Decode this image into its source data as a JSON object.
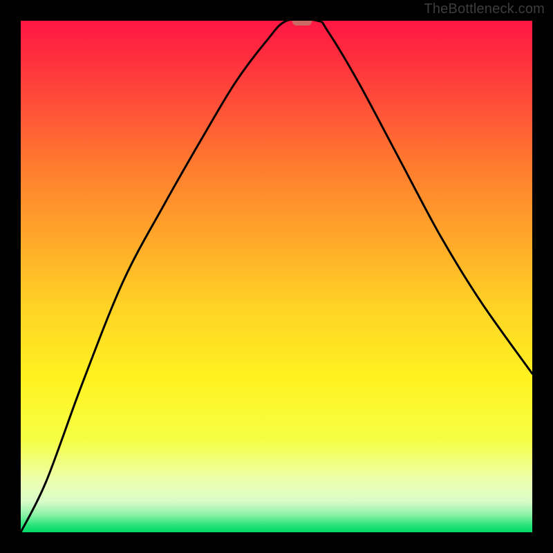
{
  "attribution": "TheBottleneck.com",
  "chart_data": {
    "type": "line",
    "title": "",
    "xlabel": "",
    "ylabel": "",
    "xlim": [
      0,
      100
    ],
    "ylim": [
      0,
      100
    ],
    "grid": false,
    "legend": null,
    "curve": [
      {
        "x": 0,
        "y": 0
      },
      {
        "x": 5,
        "y": 10
      },
      {
        "x": 12,
        "y": 29
      },
      {
        "x": 20,
        "y": 49
      },
      {
        "x": 28,
        "y": 64
      },
      {
        "x": 36,
        "y": 78
      },
      {
        "x": 42,
        "y": 88
      },
      {
        "x": 48,
        "y": 96
      },
      {
        "x": 52,
        "y": 100
      },
      {
        "x": 58,
        "y": 100
      },
      {
        "x": 60,
        "y": 98
      },
      {
        "x": 66,
        "y": 88
      },
      {
        "x": 74,
        "y": 73
      },
      {
        "x": 82,
        "y": 58
      },
      {
        "x": 90,
        "y": 45
      },
      {
        "x": 100,
        "y": 31
      }
    ],
    "marker": {
      "x": 55,
      "y": 100,
      "color": "#cb6a63"
    },
    "gradient_stops": [
      {
        "offset": 0.0,
        "color": "#ff1744"
      },
      {
        "offset": 0.06,
        "color": "#ff2a3f"
      },
      {
        "offset": 0.15,
        "color": "#ff4a39"
      },
      {
        "offset": 0.28,
        "color": "#ff7a2f"
      },
      {
        "offset": 0.42,
        "color": "#ffa62a"
      },
      {
        "offset": 0.56,
        "color": "#ffd325"
      },
      {
        "offset": 0.7,
        "color": "#fff220"
      },
      {
        "offset": 0.82,
        "color": "#f6ff45"
      },
      {
        "offset": 0.9,
        "color": "#ecffb0"
      },
      {
        "offset": 0.94,
        "color": "#d9fcc8"
      },
      {
        "offset": 0.965,
        "color": "#8ff2a8"
      },
      {
        "offset": 0.985,
        "color": "#2de57b"
      },
      {
        "offset": 1.0,
        "color": "#00d968"
      }
    ]
  }
}
